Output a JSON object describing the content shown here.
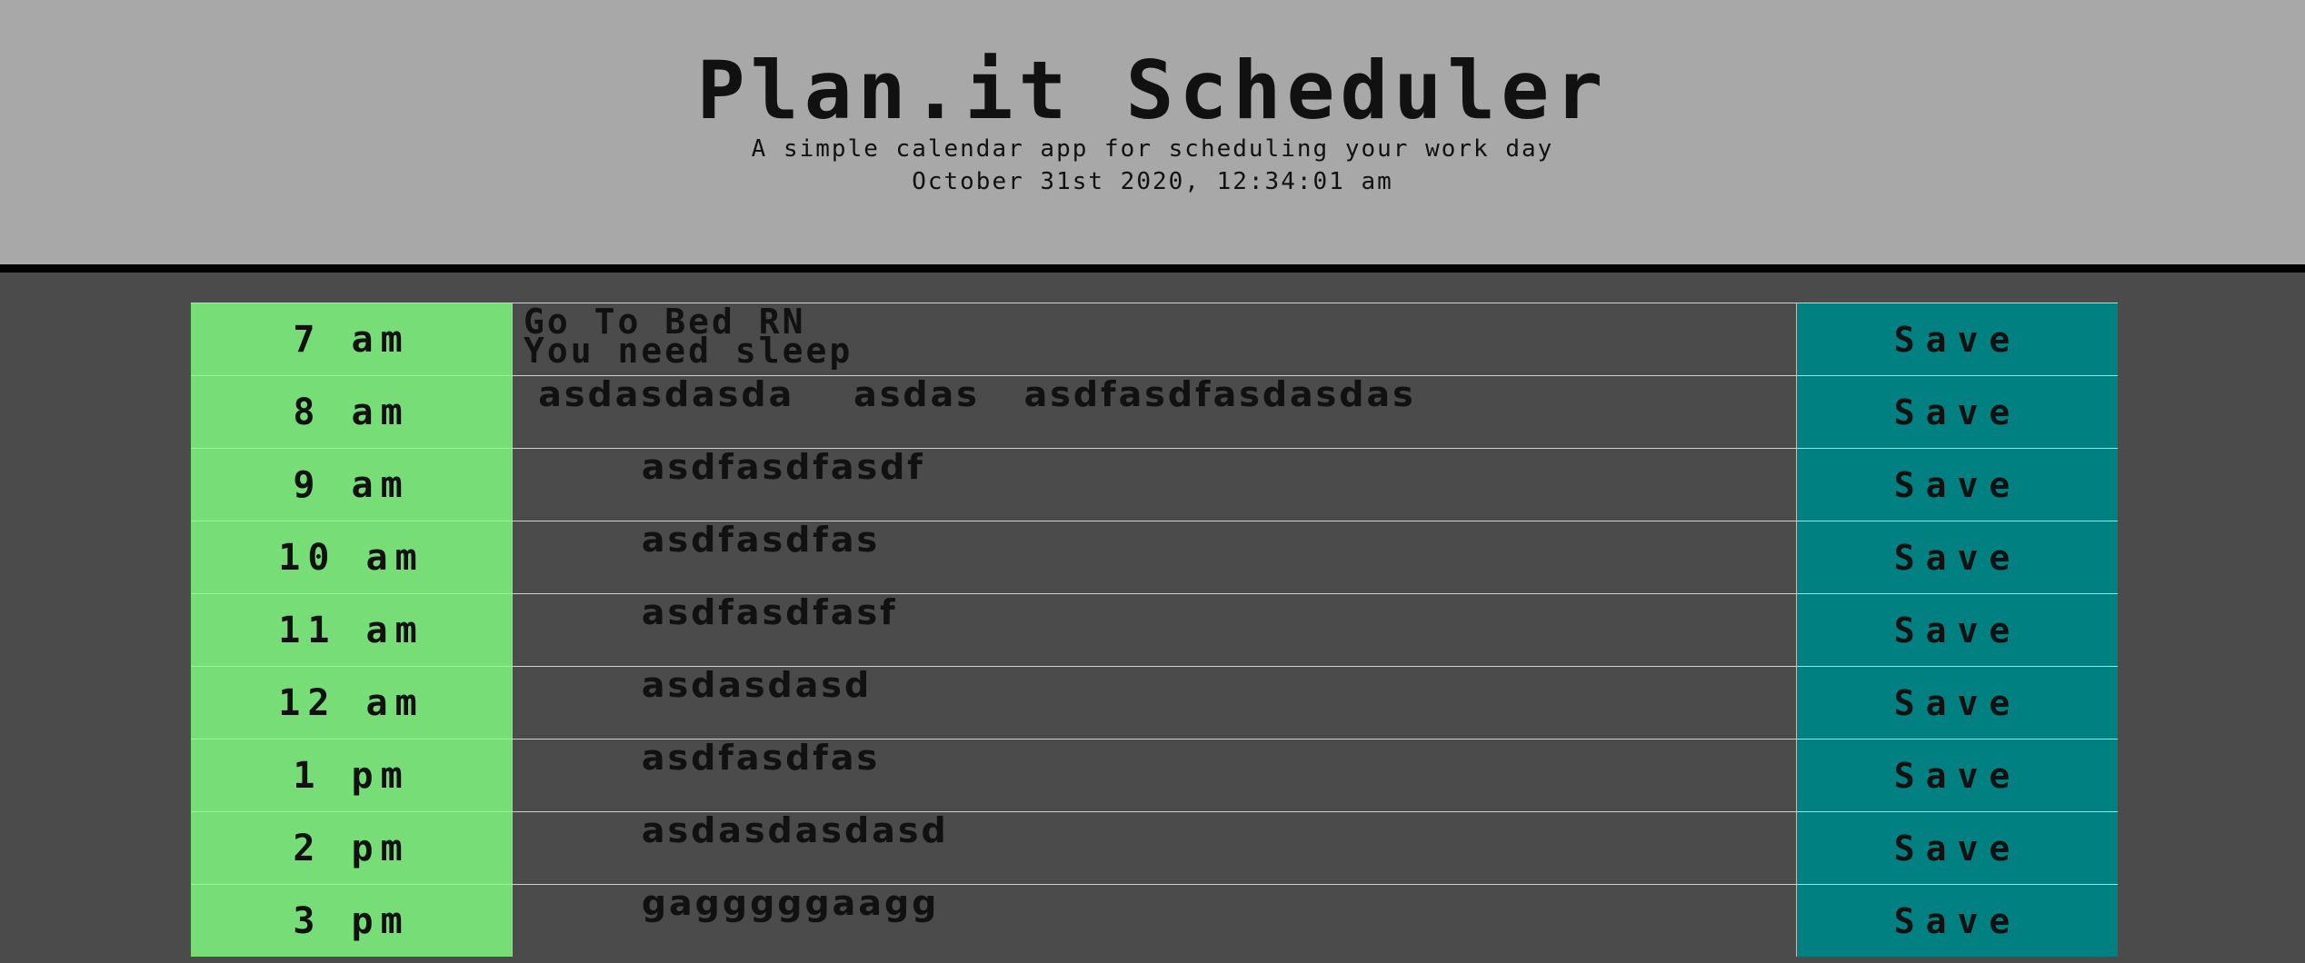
{
  "header": {
    "title": "Plan.it Scheduler",
    "subtitle": "A simple calendar app for scheduling your work day",
    "datetime": "October 31st 2020, 12:34:01 am"
  },
  "rows": [
    {
      "hour": "7 am",
      "text": "Go To Bed RN\nYou need sleep",
      "save": "Save"
    },
    {
      "hour": "8 am",
      "text": " asdasdasda    asdas   asdfasdfasdasdas",
      "save": "Save"
    },
    {
      "hour": "9 am",
      "text": "        asdfasdfasdf",
      "save": "Save"
    },
    {
      "hour": "10 am",
      "text": "        asdfasdfas",
      "save": "Save"
    },
    {
      "hour": "11 am",
      "text": "        asdfasdfasf",
      "save": "Save"
    },
    {
      "hour": "12 am",
      "text": "        asdasdasd",
      "save": "Save"
    },
    {
      "hour": "1 pm",
      "text": "        asdfasdfas",
      "save": "Save"
    },
    {
      "hour": "2 pm",
      "text": "        asdasdasdasd",
      "save": "Save"
    },
    {
      "hour": "3 pm",
      "text": "        gagggggaagg",
      "save": "Save"
    }
  ]
}
